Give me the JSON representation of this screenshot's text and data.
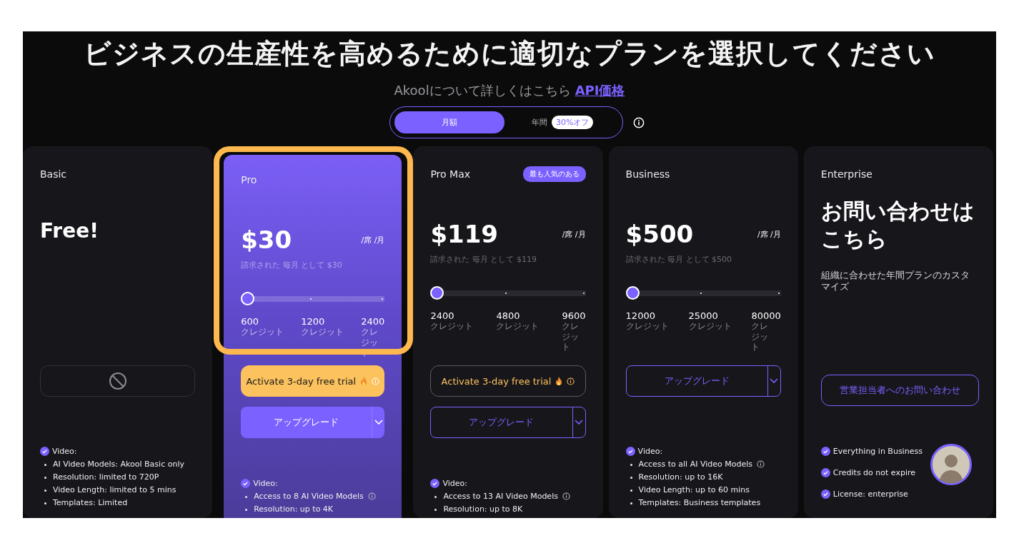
{
  "headline": "ビジネスの生産性を高めるために適切なプランを選択してください",
  "subtitle": {
    "text": "Akoolについて詳しくはこちら",
    "link": "API価格"
  },
  "billing_toggle": [
    {
      "label": "月額",
      "selected": true
    },
    {
      "label": "年間",
      "selected": false,
      "badge": "30%オフ"
    }
  ],
  "plans": [
    {
      "name": "Basic",
      "kind": "free",
      "highlighted": false,
      "price": "Free!",
      "buttons": [
        {
          "kind": "disabled"
        }
      ],
      "features": [
        {
          "kind": "group",
          "label": "Video:",
          "items": [
            {
              "text": "AI Video Models: Akool Basic only",
              "info": false
            },
            {
              "text": "Resolution: limited to 720P",
              "info": false
            },
            {
              "text": "Video Length: limited to 5 mins",
              "info": false
            },
            {
              "text": "Templates: Limited",
              "info": false
            }
          ]
        }
      ]
    },
    {
      "name": "Pro",
      "kind": "paid",
      "highlighted": true,
      "annotated": true,
      "price": "$30",
      "unit": "/席 /月",
      "note": "請求された 毎月 として $30",
      "slider": {
        "level": 0,
        "ticks": [
          {
            "amount": "600",
            "unit": "クレジット"
          },
          {
            "amount": "1200",
            "unit": "クレジット"
          },
          {
            "amount": "2400",
            "unit": "クレジット"
          }
        ]
      },
      "buttons": [
        {
          "kind": "trial",
          "label": "Activate 3-day free trial"
        },
        {
          "kind": "upgrade",
          "label": "アップグレード"
        }
      ],
      "features": [
        {
          "kind": "group",
          "label": "Video:",
          "items": [
            {
              "text": "Access to 8 AI Video Models",
              "info": true
            },
            {
              "text": "Resolution: up to 4K",
              "info": false
            }
          ]
        }
      ]
    },
    {
      "name": "Pro Max",
      "kind": "paid",
      "highlighted": false,
      "badge": "最も人気のある",
      "price": "$119",
      "unit": "/席 /月",
      "note": "請求された 毎月 として $119",
      "slider": {
        "level": 0,
        "ticks": [
          {
            "amount": "2400",
            "unit": "クレジット"
          },
          {
            "amount": "4800",
            "unit": "クレジット"
          },
          {
            "amount": "9600",
            "unit": "クレジット"
          }
        ]
      },
      "buttons": [
        {
          "kind": "trial",
          "label": "Activate 3-day free trial"
        },
        {
          "kind": "upgrade",
          "label": "アップグレード"
        }
      ],
      "features": [
        {
          "kind": "group",
          "label": "Video:",
          "items": [
            {
              "text": "Access to 13 AI Video Models",
              "info": true
            },
            {
              "text": "Resolution: up to 8K",
              "info": false
            }
          ]
        }
      ]
    },
    {
      "name": "Business",
      "kind": "paid",
      "highlighted": false,
      "price": "$500",
      "unit": "/席 /月",
      "note": "請求された 毎月 として $500",
      "slider": {
        "level": 0,
        "ticks": [
          {
            "amount": "12000",
            "unit": "クレジット"
          },
          {
            "amount": "25000",
            "unit": "クレジット"
          },
          {
            "amount": "80000",
            "unit": "クレジット"
          }
        ]
      },
      "buttons": [
        {
          "kind": "upgrade",
          "label": "アップグレード"
        }
      ],
      "features": [
        {
          "kind": "group",
          "label": "Video:",
          "items": [
            {
              "text": "Access to all AI Video Models",
              "info": true
            },
            {
              "text": "Resolution: up to 16K",
              "info": false
            },
            {
              "text": "Video Length: up to 60 mins",
              "info": false
            },
            {
              "text": "Templates: Business templates",
              "info": false
            }
          ]
        }
      ]
    },
    {
      "name": "Enterprise",
      "kind": "contact",
      "highlighted": false,
      "price": "お問い合わせはこちら",
      "description": "組織に合わせた年間プランのカスタマイズ",
      "buttons": [
        {
          "kind": "contact",
          "label": "営業担当者へのお問い合わせ"
        }
      ],
      "features": [
        {
          "kind": "check",
          "text": "Everything in Business"
        },
        {
          "kind": "check",
          "text": "Credits do not expire"
        },
        {
          "kind": "check",
          "text": "License: enterprise"
        }
      ]
    }
  ]
}
